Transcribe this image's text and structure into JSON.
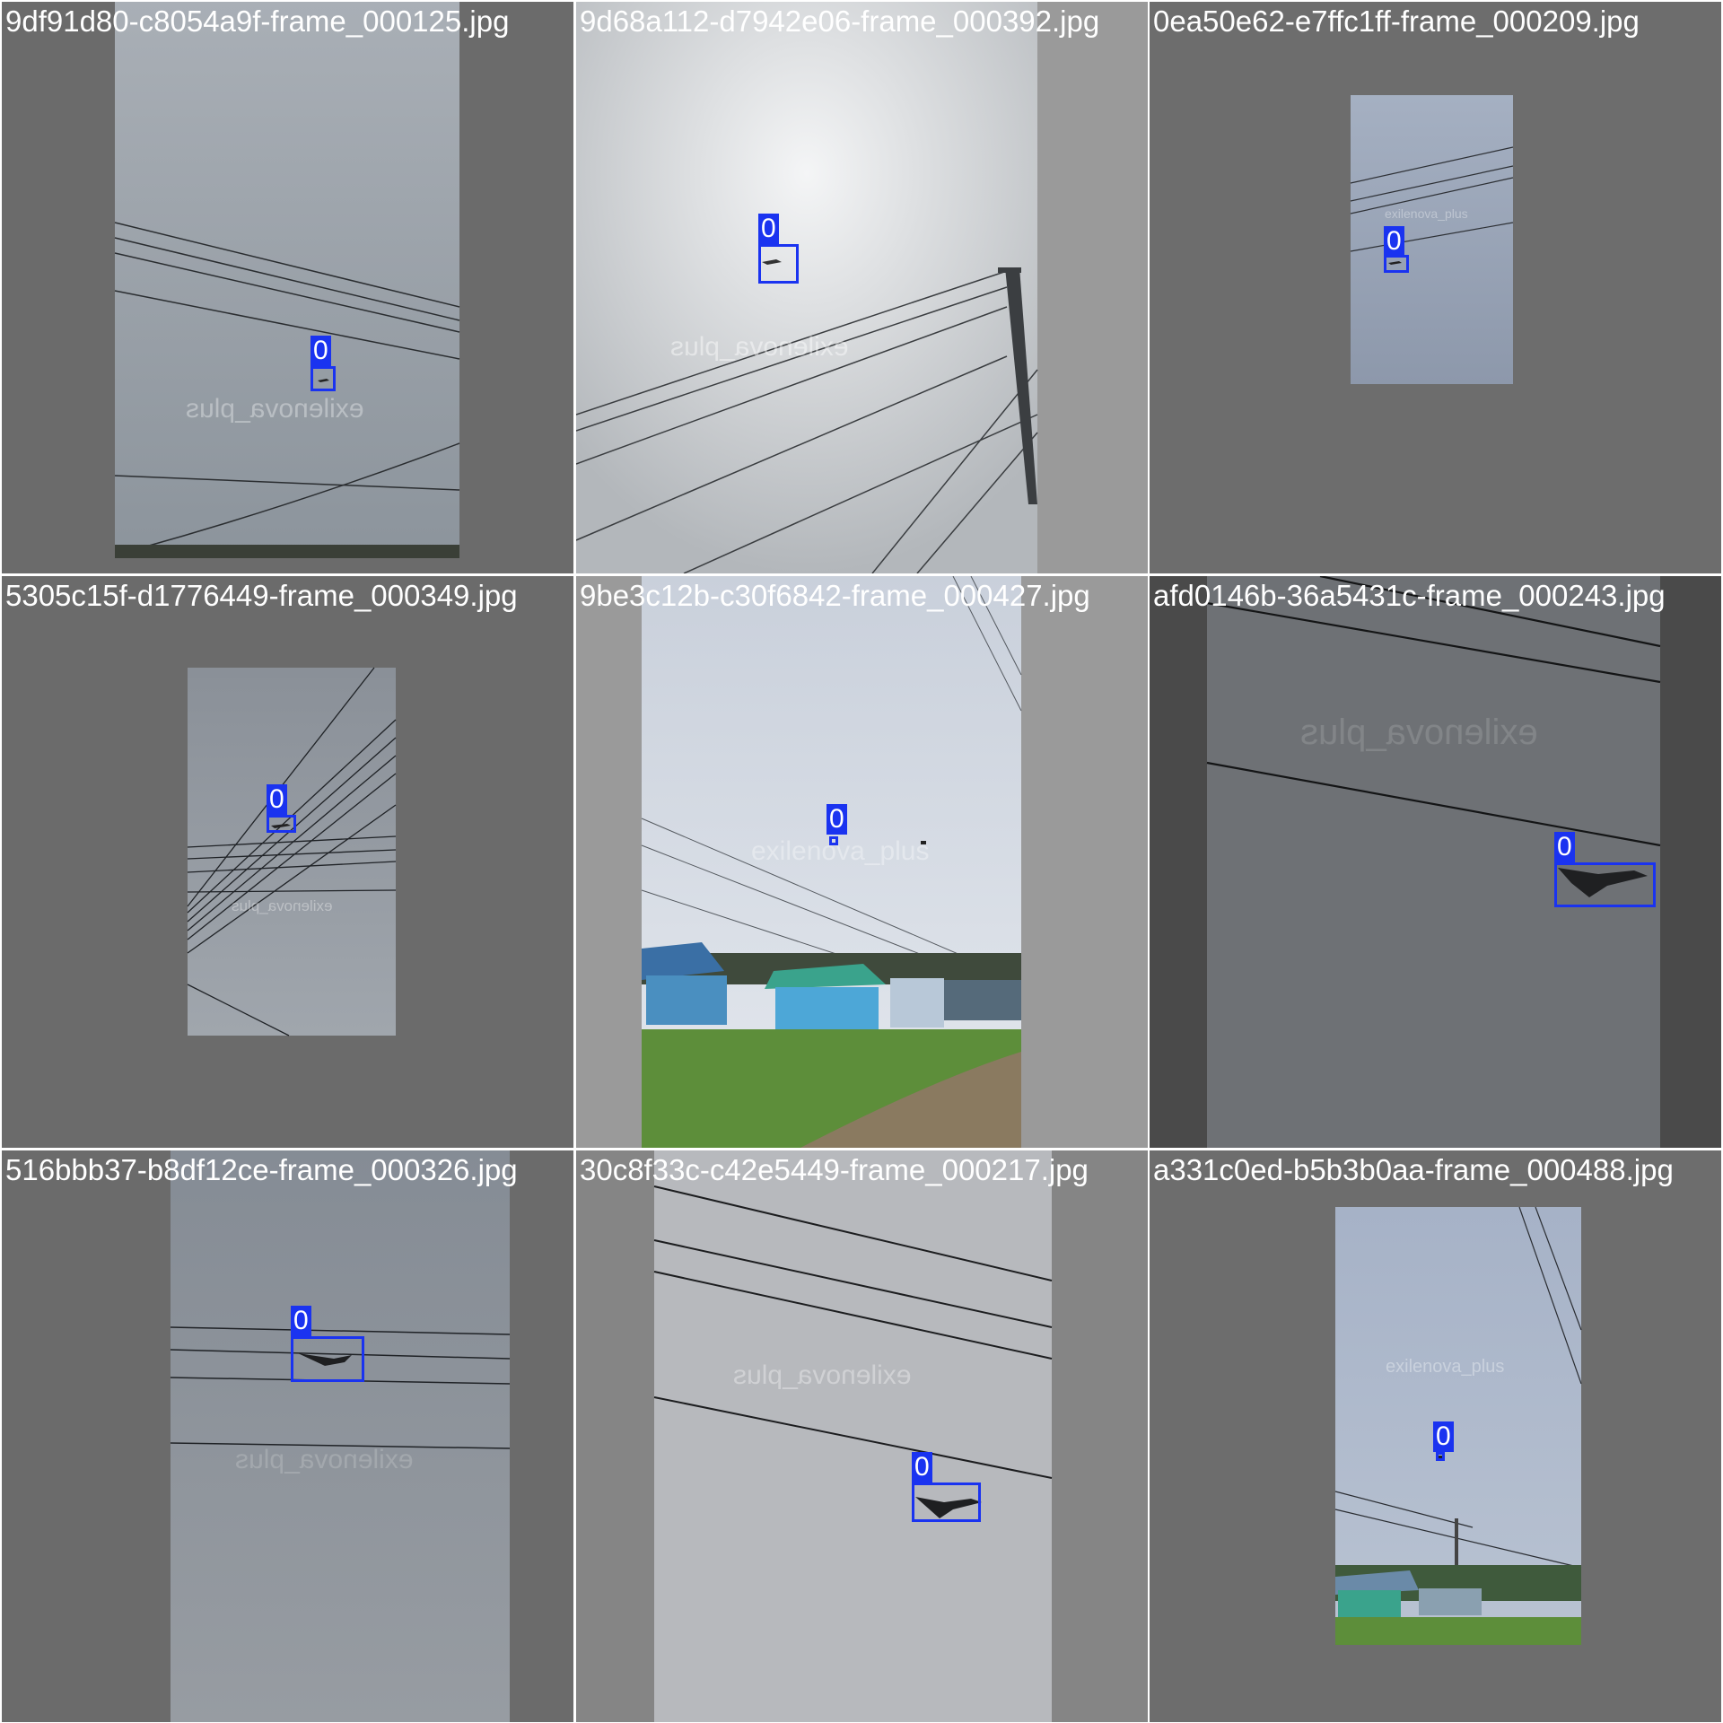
{
  "grid": {
    "rows": 3,
    "cols": 3
  },
  "class_label": "0",
  "box_color": "#1a33f0",
  "watermark": "exilenova_plus",
  "tiles": [
    {
      "filename": "9df91d80-c8054a9f-frame_000125.jpg"
    },
    {
      "filename": "9d68a112-d7942e06-frame_000392.jpg"
    },
    {
      "filename": "0ea50e62-e7ffc1ff-frame_000209.jpg"
    },
    {
      "filename": "5305c15f-d1776449-frame_000349.jpg"
    },
    {
      "filename": "9be3c12b-c30f6842-frame_000427.jpg"
    },
    {
      "filename": "afd0146b-36a5431c-frame_000243.jpg"
    },
    {
      "filename": "516bbb37-b8df12ce-frame_000326.jpg"
    },
    {
      "filename": "30c8f33c-c42e5449-frame_000217.jpg"
    },
    {
      "filename": "a331c0ed-b5b3b0aa-frame_000488.jpg"
    }
  ]
}
